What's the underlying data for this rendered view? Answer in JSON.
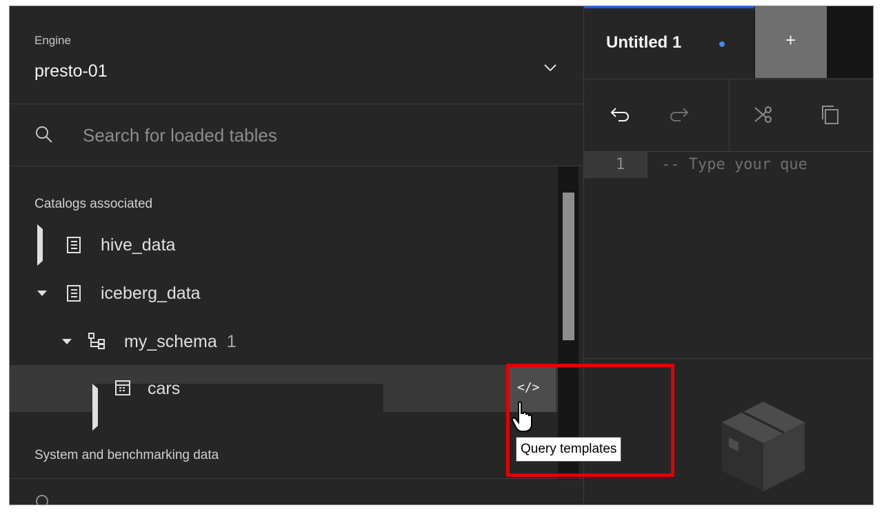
{
  "engine": {
    "label": "Engine",
    "value": "presto-01"
  },
  "search": {
    "placeholder": "Search for loaded tables"
  },
  "sections": {
    "catalogs": "Catalogs associated",
    "system": "System and benchmarking data"
  },
  "tree": {
    "hive": "hive_data",
    "iceberg": "iceberg_data",
    "schema": "my_schema",
    "schema_count": "1",
    "table": "cars"
  },
  "code_button": "</>",
  "tooltip": "Query templates",
  "tabs": [
    {
      "label": "Untitled 1",
      "unsaved": true
    }
  ],
  "add_tab": "+",
  "editor": {
    "line_number": "1",
    "placeholder": "-- Type your que"
  },
  "colors": {
    "accent": "#0f62fe",
    "dot": "#4589ff",
    "highlight": "#e00000"
  },
  "icons": [
    "chevron-down-icon",
    "search-icon",
    "catalog-icon",
    "schema-icon",
    "table-icon",
    "undo-icon",
    "redo-icon",
    "cut-icon",
    "copy-icon",
    "empty-box-icon",
    "hand-cursor-icon"
  ]
}
